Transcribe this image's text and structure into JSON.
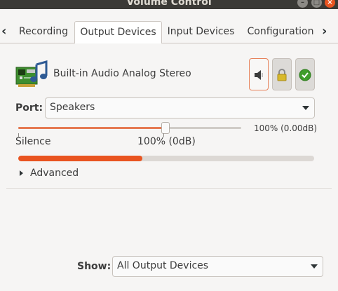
{
  "window": {
    "title": "Volume Control"
  },
  "tabs": [
    {
      "label": "Recording",
      "active": false
    },
    {
      "label": "Output Devices",
      "active": true
    },
    {
      "label": "Input Devices",
      "active": false
    },
    {
      "label": "Configuration",
      "active": false
    }
  ],
  "device": {
    "name": "Built-in Audio Analog Stereo",
    "icon": "audio-card-icon",
    "port_label": "Port:",
    "port_value": "Speakers",
    "volume_readout": "100% (0.00dB)",
    "volume_fraction": 0.66,
    "silence_label": "Silence",
    "mark_label": "100% (0dB)",
    "peak_fraction": 0.42,
    "advanced_label": "Advanced"
  },
  "footer": {
    "show_label": "Show:",
    "show_value": "All Output Devices"
  },
  "colors": {
    "accent": "#e95420",
    "slider_fill": "#e57a52",
    "titlebar": "#3b3a36",
    "default_check": "#3f9d2a",
    "lock": "#d8b92b"
  }
}
